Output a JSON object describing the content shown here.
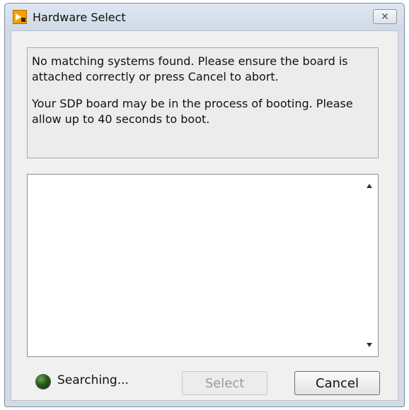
{
  "window": {
    "title": "Hardware Select",
    "close_symbol": "✕"
  },
  "message": {
    "line1": "No matching systems found. Please ensure the board is attached correctly or press Cancel to abort.",
    "line2": "Your SDP board may be in the process of booting. Please allow up to 40 seconds to boot."
  },
  "list": {
    "items": []
  },
  "status": {
    "label": "Searching...",
    "led_color": "#245c16"
  },
  "buttons": {
    "select": "Select",
    "cancel": "Cancel"
  },
  "icons": {
    "app": "labview-app-icon",
    "close": "close-icon",
    "scroll_up": "scroll-up-arrow-icon",
    "scroll_down": "scroll-down-arrow-icon"
  }
}
